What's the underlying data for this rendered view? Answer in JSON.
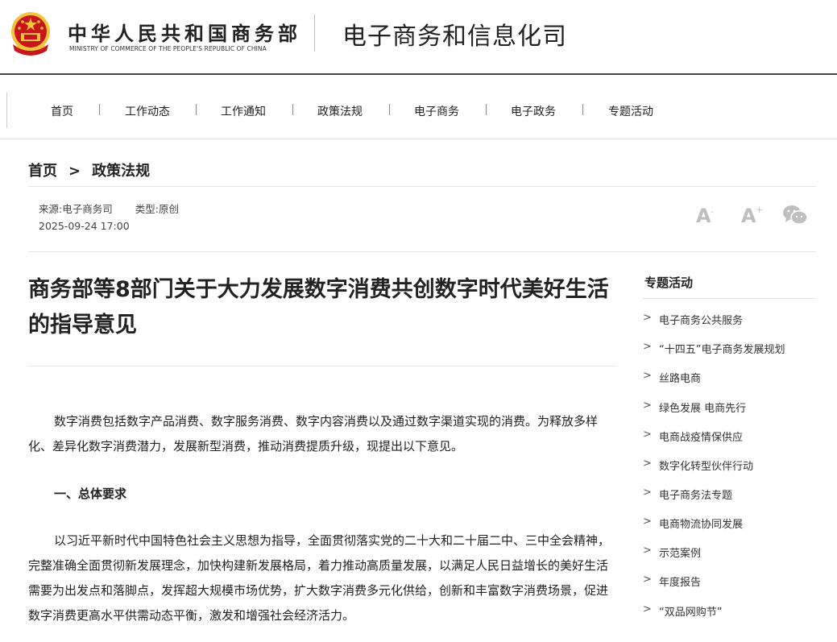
{
  "header": {
    "ministry_cn": "中华人民共和国商务部",
    "ministry_en": "MINISTRY OF COMMERCE OF THE PEOPLE'S REPUBLIC OF CHINA",
    "department": "电子商务和信息化司"
  },
  "nav": {
    "items": [
      "首页",
      "工作动态",
      "工作通知",
      "政策法规",
      "电子商务",
      "电子政务",
      "专题活动"
    ]
  },
  "breadcrumb": {
    "home": "首页",
    "separator": ">",
    "current": "政策法规"
  },
  "meta": {
    "source_label": "来源:",
    "source_value": "电子商务司",
    "type_label": "类型:",
    "type_value": "原创",
    "datetime": "2025-09-24 17:00"
  },
  "tools": {
    "font_decrease": "A",
    "font_increase": "A",
    "share_icon": "wechat-icon"
  },
  "article": {
    "title": "商务部等8部门关于大力发展数字消费共创数字时代美好生活的指导意见",
    "para1": "数字消费包括数字产品消费、数字服务消费、数字内容消费以及通过数字渠道实现的消费。为释放多样化、差异化数字消费潜力，发展新型消费，推动消费提质升级，现提出以下意见。",
    "section1": "一、总体要求",
    "para2": "以习近平新时代中国特色社会主义思想为指导，全面贯彻落实党的二十大和二十届二中、三中全会精神，完整准确全面贯彻新发展理念，加快构建新发展格局，着力推动高质量发展，以满足人民日益增长的美好生活需要为出发点和落脚点，发挥超大规模市场优势，扩大数字消费多元化供给，创新和丰富数字消费场景，促进数字消费更高水平供需动态平衡，激发和增强社会经济活力。"
  },
  "sidebar": {
    "title": "专题活动",
    "chevron": ">",
    "items": [
      "电子商务公共服务",
      "“十四五”电子商务发展规划",
      "丝路电商",
      "绿色发展 电商先行",
      "电商战疫情保供应",
      "数字化转型伙伴行动",
      "电子商务法专题",
      "电商物流协同发展",
      "示范案例",
      "年度报告",
      "“双品网购节”"
    ]
  },
  "colors": {
    "emblem_red": "#c8161d",
    "emblem_gold": "#f3c43a",
    "text_dark": "#222222",
    "icon_grey": "#bfbfbf"
  }
}
